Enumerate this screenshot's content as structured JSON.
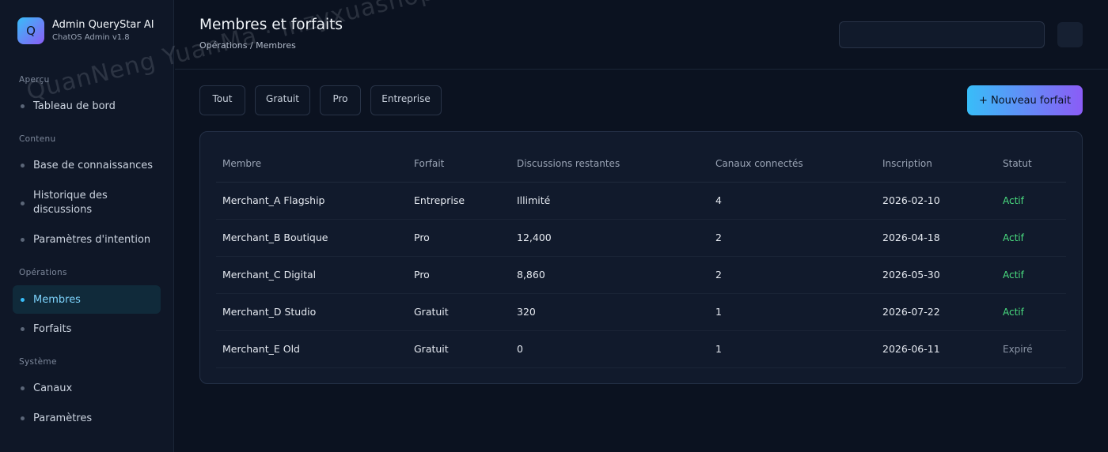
{
  "brand": {
    "logo_letter": "Q",
    "title": "Admin QueryStar AI",
    "subtitle": "ChatOS Admin v1.8"
  },
  "sidebar": {
    "sections": [
      {
        "label": "Aperçu",
        "items": [
          {
            "label": "Tableau de bord",
            "active": false
          }
        ]
      },
      {
        "label": "Contenu",
        "items": [
          {
            "label": "Base de connaissances",
            "active": false
          },
          {
            "label": "Historique des discussions",
            "active": false
          },
          {
            "label": "Paramètres d'intention",
            "active": false
          }
        ]
      },
      {
        "label": "Opérations",
        "items": [
          {
            "label": "Membres",
            "active": true
          },
          {
            "label": "Forfaits",
            "active": false
          }
        ]
      },
      {
        "label": "Système",
        "items": [
          {
            "label": "Canaux",
            "active": false
          },
          {
            "label": "Paramètres",
            "active": false
          }
        ]
      }
    ]
  },
  "header": {
    "title": "Membres et forfaits",
    "breadcrumb": "Opérations / Membres",
    "search_value": ""
  },
  "filters": [
    "Tout",
    "Gratuit",
    "Pro",
    "Entreprise"
  ],
  "new_button": "+ Nouveau forfait",
  "table": {
    "columns": [
      "Membre",
      "Forfait",
      "Discussions restantes",
      "Canaux connectés",
      "Inscription",
      "Statut"
    ],
    "rows": [
      [
        "Merchant_A Flagship",
        "Entreprise",
        "Illimité",
        "4",
        "2026-02-10",
        "Actif"
      ],
      [
        "Merchant_B Boutique",
        "Pro",
        "12,400",
        "2",
        "2026-04-18",
        "Actif"
      ],
      [
        "Merchant_C Digital",
        "Pro",
        "8,860",
        "2",
        "2026-05-30",
        "Actif"
      ],
      [
        "Merchant_D Studio",
        "Gratuit",
        "320",
        "1",
        "2026-07-22",
        "Actif"
      ],
      [
        "Merchant_E Old",
        "Gratuit",
        "0",
        "1",
        "2026-06-11",
        "Expiré"
      ]
    ]
  },
  "watermark": "QuanNeng YuanMa · inzyxuashop.com",
  "colors": {
    "accent_start": "#38bdf8",
    "accent_end": "#8b5cf6",
    "status_active": "#4ade80",
    "status_expired": "#8b95a6"
  }
}
